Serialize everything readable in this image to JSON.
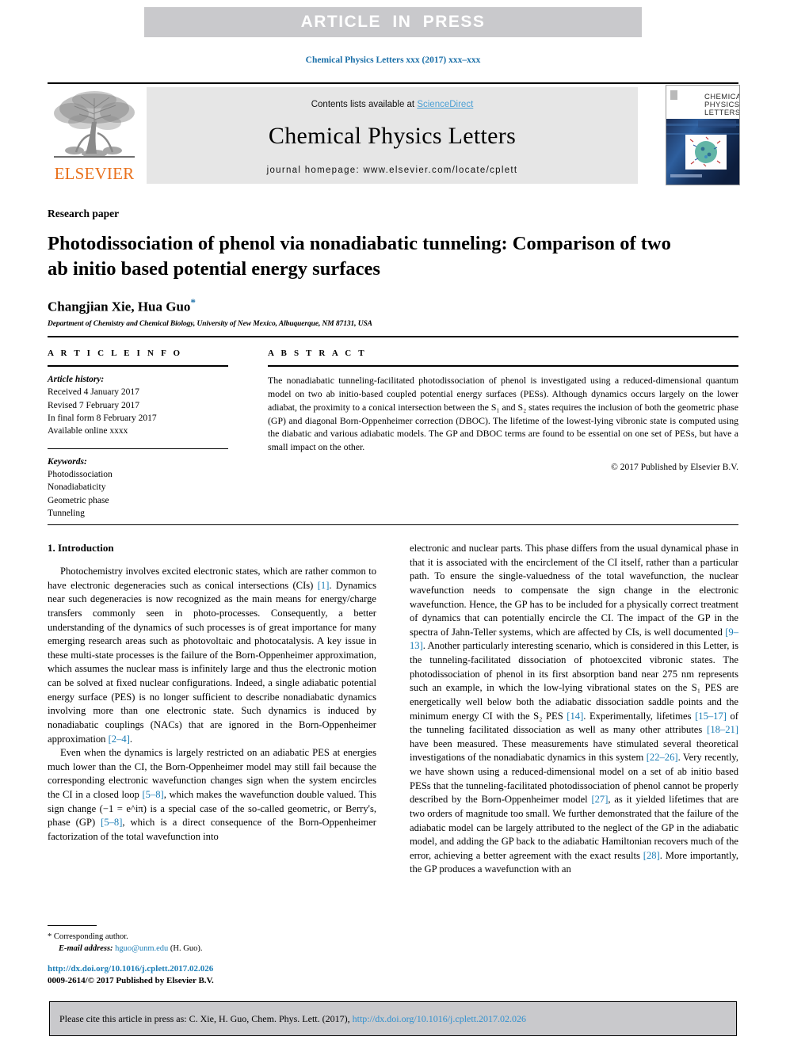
{
  "banner": {
    "text": "ARTICLE  IN  PRESS"
  },
  "running_head": "Chemical Physics Letters xxx (2017) xxx–xxx",
  "masthead": {
    "contents_prefix": "Contents lists available at ",
    "sciencedirect": "ScienceDirect",
    "journal_title": "Chemical Physics Letters",
    "homepage": "journal homepage: www.elsevier.com/locate/cplett",
    "publisher_wordmark": "ELSEVIER",
    "cover_title_line1": "CHEMICAL",
    "cover_title_line2": "PHYSICS",
    "cover_title_line3": "LETTERS"
  },
  "article": {
    "type": "Research paper",
    "title": "Photodissociation of phenol via nonadiabatic tunneling: Comparison of two ab initio based potential energy surfaces",
    "authors": "Changjian Xie, Hua Guo",
    "corresponding_marker": "*",
    "affiliation": "Department of Chemistry and Chemical Biology, University of New Mexico, Albuquerque, NM 87131, USA"
  },
  "article_info": {
    "heading": "A R T I C L E   I N F O",
    "history_title": "Article history:",
    "history": [
      "Received 4 January 2017",
      "Revised 7 February 2017",
      "In final form 8 February 2017",
      "Available online xxxx"
    ],
    "keywords_title": "Keywords:",
    "keywords": [
      "Photodissociation",
      "Nonadiabaticity",
      "Geometric phase",
      "Tunneling"
    ]
  },
  "abstract": {
    "heading": "A B S T R A C T",
    "text": "The nonadiabatic tunneling-facilitated photodissociation of phenol is investigated using a reduced-dimensional quantum model on two ab initio-based coupled potential energy surfaces (PESs). Although dynamics occurs largely on the lower adiabat, the proximity to a conical intersection between the S₁ and S₂ states requires the inclusion of both the geometric phase (GP) and diagonal Born-Oppenheimer correction (DBOC). The lifetime of the lowest-lying vibronic state is computed using the diabatic and various adiabatic models. The GP and DBOC terms are found to be essential on one set of PESs, but have a small impact on the other.",
    "copyright": "© 2017 Published by Elsevier B.V."
  },
  "body": {
    "section_heading": "1. Introduction",
    "left_paragraphs": [
      "Photochemistry involves excited electronic states, which are rather common to have electronic degeneracies such as conical intersections (CIs) [1]. Dynamics near such degeneracies is now recognized as the main means for energy/charge transfers commonly seen in photo-processes. Consequently, a better understanding of the dynamics of such processes is of great importance for many emerging research areas such as photovoltaic and photocatalysis. A key issue in these multi-state processes is the failure of the Born-Oppenheimer approximation, which assumes the nuclear mass is infinitely large and thus the electronic motion can be solved at fixed nuclear configurations. Indeed, a single adiabatic potential energy surface (PES) is no longer sufficient to describe nonadiabatic dynamics involving more than one electronic state. Such dynamics is induced by nonadiabatic couplings (NACs) that are ignored in the Born-Oppenheimer approximation [2–4].",
      "Even when the dynamics is largely restricted on an adiabatic PES at energies much lower than the CI, the Born-Oppenheimer model may still fail because the corresponding electronic wavefunction changes sign when the system encircles the CI in a closed loop [5–8], which makes the wavefunction double valued. This sign change (−1 = e^iπ) is a special case of the so-called geometric, or Berry's, phase (GP) [5–8], which is a direct consequence of the Born-Oppenheimer factorization of the total wavefunction into"
    ],
    "right_paragraphs": [
      "electronic and nuclear parts. This phase differs from the usual dynamical phase in that it is associated with the encirclement of the CI itself, rather than a particular path. To ensure the single-valuedness of the total wavefunction, the nuclear wavefunction needs to compensate the sign change in the electronic wavefunction. Hence, the GP has to be included for a physically correct treatment of dynamics that can potentially encircle the CI. The impact of the GP in the spectra of Jahn-Teller systems, which are affected by CIs, is well documented [9–13]. Another particularly interesting scenario, which is considered in this Letter, is the tunneling-facilitated dissociation of photoexcited vibronic states. The photodissociation of phenol in its first absorption band near 275 nm represents such an example, in which the low-lying vibrational states on the S₁ PES are energetically well below both the adiabatic dissociation saddle points and the minimum energy CI with the S₂ PES [14]. Experimentally, lifetimes [15–17] of the tunneling facilitated dissociation as well as many other attributes [18–21] have been measured. These measurements have stimulated several theoretical investigations of the nonadiabatic dynamics in this system [22–26]. Very recently, we have shown using a reduced-dimensional model on a set of ab initio based PESs that the tunneling-facilitated photodissociation of phenol cannot be properly described by the Born-Oppenheimer model [27], as it yielded lifetimes that are two orders of magnitude too small. We further demonstrated that the failure of the adiabatic model can be largely attributed to the neglect of the GP in the adiabatic model, and adding the GP back to the adiabatic Hamiltonian recovers much of the error, achieving a better agreement with the exact results [28]. More importantly, the GP produces a wavefunction with an"
    ]
  },
  "footnote": {
    "star": "*",
    "corresponding": "Corresponding author.",
    "email_label": "E-mail address:",
    "email": "hguo@unm.edu",
    "email_suffix": "(H. Guo)."
  },
  "publication": {
    "doi_url": "http://dx.doi.org/10.1016/j.cplett.2017.02.026",
    "issn_line": "0009-2614/© 2017 Published by Elsevier B.V."
  },
  "cite_footer": {
    "prefix": "Please cite this article in press as: C. Xie, H. Guo, Chem. Phys. Lett. (2017), ",
    "url": "http://dx.doi.org/10.1016/j.cplett.2017.02.026"
  },
  "colors": {
    "banner_gray": "#c9c9cc",
    "link_blue": "#1a7cb5",
    "sciencedirect_blue": "#4a9fd4",
    "elsevier_orange": "#e9711c",
    "masthead_gray": "#e6e6e6"
  }
}
